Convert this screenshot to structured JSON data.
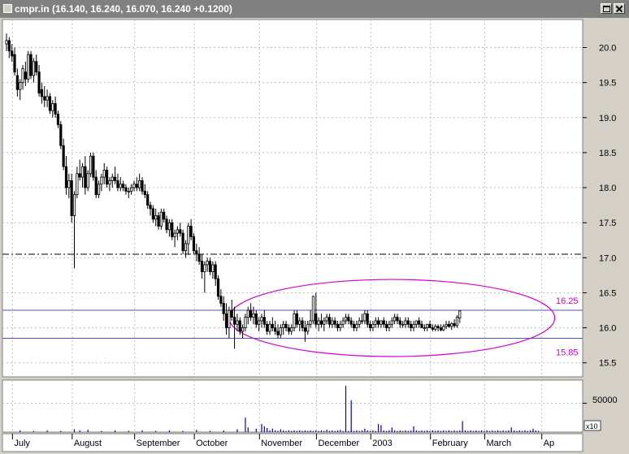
{
  "window": {
    "symbol": "cmpr.in",
    "quote": "(16.140, 16.240, 16.070, 16.240 +0.1200)"
  },
  "colors": {
    "candle": "#000000",
    "volume": "#0000cc",
    "support_resistance": "#5050c0",
    "ellipse": "#d000d0",
    "level_label": "#cc00cc",
    "grid": "#c0c0c0",
    "background": "#ffffff"
  },
  "chart_data": {
    "type": "candlestick",
    "x_unit": "trading day index from first bar",
    "ylim": [
      15.3,
      20.4
    ],
    "price_ticks": [
      "20.0",
      "19.5",
      "19.0",
      "18.5",
      "18.0",
      "17.5",
      "17.0",
      "16.5",
      "16.0",
      "15.5"
    ],
    "month_labels": [
      {
        "label": "July",
        "day": 4
      },
      {
        "label": "August",
        "day": 26
      },
      {
        "label": "September",
        "day": 49
      },
      {
        "label": "October",
        "day": 71
      },
      {
        "label": "November",
        "day": 95
      },
      {
        "label": "December",
        "day": 116
      },
      {
        "label": "2003",
        "day": 136
      },
      {
        "label": "February",
        "day": 158
      },
      {
        "label": "March",
        "day": 178
      },
      {
        "label": "Ap",
        "day": 199
      }
    ],
    "reference_lines": [
      {
        "value": 17.05,
        "style": "dash-dot"
      },
      {
        "value": 16.25,
        "style": "solid",
        "label": "16.25"
      },
      {
        "value": 15.85,
        "style": "solid",
        "label": "15.85"
      }
    ],
    "ellipse": {
      "day_from": 82,
      "day_to": 202,
      "price_from": 15.59,
      "price_to": 16.69
    },
    "volume_axis": {
      "label": "50000",
      "tick_value": 50000,
      "scale_label": "x10",
      "ylim": [
        0,
        90000
      ]
    },
    "last_close": 16.24,
    "ohlc": [
      [
        20.05,
        20.2,
        19.95,
        20.1
      ],
      [
        20.1,
        20.15,
        19.85,
        19.95
      ],
      [
        19.95,
        20.05,
        19.8,
        19.88
      ],
      [
        19.9,
        20.0,
        19.6,
        19.65
      ],
      [
        19.6,
        19.7,
        19.3,
        19.4
      ],
      [
        19.4,
        19.55,
        19.25,
        19.5
      ],
      [
        19.5,
        19.75,
        19.4,
        19.7
      ],
      [
        19.65,
        19.8,
        19.45,
        19.55
      ],
      [
        19.55,
        19.95,
        19.5,
        19.9
      ],
      [
        19.9,
        19.95,
        19.55,
        19.6
      ],
      [
        19.6,
        19.85,
        19.5,
        19.8
      ],
      [
        19.8,
        19.9,
        19.6,
        19.65
      ],
      [
        19.65,
        19.75,
        19.3,
        19.35
      ],
      [
        19.4,
        19.5,
        19.2,
        19.3
      ],
      [
        19.3,
        19.45,
        19.15,
        19.25
      ],
      [
        19.25,
        19.4,
        19.15,
        19.3
      ],
      [
        19.3,
        19.35,
        19.05,
        19.1
      ],
      [
        19.1,
        19.25,
        19.0,
        19.2
      ],
      [
        19.2,
        19.3,
        19.0,
        19.05
      ],
      [
        19.05,
        19.1,
        18.85,
        18.9
      ],
      [
        18.9,
        18.95,
        18.55,
        18.6
      ],
      [
        18.6,
        18.7,
        18.25,
        18.3
      ],
      [
        18.3,
        18.45,
        17.9,
        18.0
      ],
      [
        18.0,
        18.2,
        17.85,
        18.1
      ],
      [
        18.1,
        18.2,
        17.5,
        17.6
      ],
      [
        17.6,
        17.95,
        16.85,
        17.9
      ],
      [
        17.9,
        18.3,
        17.85,
        18.2
      ],
      [
        18.2,
        18.4,
        18.1,
        18.15
      ],
      [
        18.15,
        18.35,
        18.0,
        18.3
      ],
      [
        18.3,
        18.45,
        17.9,
        18.0
      ],
      [
        18.0,
        18.25,
        17.95,
        18.2
      ],
      [
        18.2,
        18.5,
        18.15,
        18.45
      ],
      [
        18.45,
        18.5,
        18.1,
        18.15
      ],
      [
        18.15,
        18.25,
        17.85,
        17.9
      ],
      [
        17.9,
        18.1,
        17.85,
        18.05
      ],
      [
        18.05,
        18.2,
        17.95,
        18.15
      ],
      [
        18.15,
        18.35,
        18.05,
        18.25
      ],
      [
        18.25,
        18.3,
        18.0,
        18.05
      ],
      [
        18.05,
        18.15,
        17.95,
        18.1
      ],
      [
        18.1,
        18.2,
        18.0,
        18.15
      ],
      [
        18.15,
        18.3,
        18.05,
        18.1
      ],
      [
        18.1,
        18.2,
        17.95,
        18.0
      ],
      [
        18.0,
        18.15,
        17.95,
        18.05
      ],
      [
        18.05,
        18.1,
        17.95,
        18.0
      ],
      [
        18.0,
        18.05,
        17.9,
        17.95
      ],
      [
        17.95,
        18.0,
        17.85,
        17.95
      ],
      [
        17.95,
        18.05,
        17.9,
        18.0
      ],
      [
        18.0,
        18.1,
        17.95,
        18.05
      ],
      [
        18.05,
        18.15,
        17.95,
        18.0
      ],
      [
        18.0,
        18.2,
        17.95,
        18.1
      ],
      [
        18.1,
        18.15,
        17.9,
        17.95
      ],
      [
        17.95,
        18.05,
        17.85,
        17.9
      ],
      [
        17.9,
        17.95,
        17.7,
        17.75
      ],
      [
        17.75,
        17.8,
        17.6,
        17.7
      ],
      [
        17.7,
        17.75,
        17.5,
        17.55
      ],
      [
        17.55,
        17.7,
        17.45,
        17.6
      ],
      [
        17.6,
        17.65,
        17.4,
        17.45
      ],
      [
        17.45,
        17.7,
        17.4,
        17.65
      ],
      [
        17.65,
        17.7,
        17.5,
        17.55
      ],
      [
        17.55,
        17.6,
        17.35,
        17.4
      ],
      [
        17.4,
        17.55,
        17.3,
        17.5
      ],
      [
        17.5,
        17.55,
        17.25,
        17.3
      ],
      [
        17.3,
        17.4,
        17.15,
        17.35
      ],
      [
        17.35,
        17.45,
        17.25,
        17.4
      ],
      [
        17.4,
        17.5,
        17.3,
        17.35
      ],
      [
        17.35,
        17.4,
        17.05,
        17.1
      ],
      [
        17.1,
        17.25,
        17.0,
        17.2
      ],
      [
        17.2,
        17.5,
        17.05,
        17.45
      ],
      [
        17.45,
        17.55,
        17.25,
        17.3
      ],
      [
        17.3,
        17.35,
        17.05,
        17.1
      ],
      [
        17.1,
        17.2,
        16.95,
        17.05
      ],
      [
        17.05,
        17.15,
        16.9,
        16.95
      ],
      [
        16.95,
        17.05,
        16.7,
        16.8
      ],
      [
        16.8,
        16.95,
        16.5,
        16.9
      ],
      [
        16.9,
        17.0,
        16.8,
        16.95
      ],
      [
        16.95,
        17.0,
        16.75,
        16.8
      ],
      [
        16.8,
        16.95,
        16.7,
        16.9
      ],
      [
        16.9,
        16.95,
        16.6,
        16.7
      ],
      [
        16.7,
        16.75,
        16.4,
        16.45
      ],
      [
        16.45,
        16.55,
        16.3,
        16.35
      ],
      [
        16.35,
        16.45,
        16.1,
        16.2
      ],
      [
        16.2,
        16.35,
        15.9,
        16.0
      ],
      [
        16.0,
        16.3,
        15.85,
        16.25
      ],
      [
        16.25,
        16.4,
        16.1,
        16.15
      ],
      [
        16.15,
        16.3,
        15.7,
        16.05
      ],
      [
        16.05,
        16.2,
        15.95,
        16.1
      ],
      [
        16.1,
        16.15,
        15.9,
        15.95
      ],
      [
        15.95,
        16.05,
        15.85,
        16.0
      ],
      [
        16.0,
        16.2,
        15.95,
        16.15
      ],
      [
        16.15,
        16.3,
        16.05,
        16.25
      ],
      [
        16.25,
        16.35,
        16.1,
        16.15
      ],
      [
        16.15,
        16.3,
        16.05,
        16.2
      ],
      [
        16.2,
        16.25,
        16.0,
        16.05
      ],
      [
        16.05,
        16.15,
        15.95,
        16.1
      ],
      [
        16.1,
        16.2,
        16.0,
        16.15
      ],
      [
        16.15,
        16.25,
        16.0,
        16.05
      ],
      [
        16.05,
        16.1,
        15.9,
        15.95
      ],
      [
        15.95,
        16.1,
        15.9,
        16.05
      ],
      [
        16.05,
        16.15,
        15.95,
        16.0
      ],
      [
        16.0,
        16.1,
        15.9,
        15.95
      ],
      [
        15.95,
        16.05,
        15.85,
        15.9
      ],
      [
        15.9,
        16.05,
        15.85,
        16.0
      ],
      [
        16.0,
        16.1,
        15.9,
        16.05
      ],
      [
        16.05,
        16.1,
        15.95,
        16.0
      ],
      [
        16.0,
        16.05,
        15.9,
        15.95
      ],
      [
        15.95,
        16.05,
        15.9,
        16.0
      ],
      [
        16.0,
        16.25,
        15.95,
        16.2
      ],
      [
        16.2,
        16.25,
        16.0,
        16.05
      ],
      [
        16.05,
        16.15,
        15.95,
        16.1
      ],
      [
        16.1,
        16.15,
        15.95,
        16.0
      ],
      [
        16.0,
        16.1,
        15.8,
        15.95
      ],
      [
        15.95,
        16.1,
        15.9,
        16.05
      ],
      [
        16.05,
        16.25,
        16.0,
        16.1
      ],
      [
        16.1,
        16.35,
        16.05,
        16.45
      ],
      [
        16.2,
        16.5,
        16.0,
        16.05
      ],
      [
        16.05,
        16.15,
        15.95,
        16.1
      ],
      [
        16.1,
        16.2,
        16.0,
        16.05
      ],
      [
        16.05,
        16.15,
        15.95,
        16.1
      ],
      [
        16.1,
        16.2,
        16.05,
        16.15
      ],
      [
        16.15,
        16.2,
        16.0,
        16.05
      ],
      [
        16.05,
        16.15,
        16.0,
        16.1
      ],
      [
        16.1,
        16.15,
        16.0,
        16.05
      ],
      [
        16.05,
        16.1,
        15.95,
        16.0
      ],
      [
        16.0,
        16.1,
        15.95,
        16.05
      ],
      [
        16.05,
        16.15,
        16.0,
        16.1
      ],
      [
        16.1,
        16.2,
        16.05,
        16.15
      ],
      [
        16.15,
        16.2,
        16.05,
        16.1
      ],
      [
        16.1,
        16.15,
        16.0,
        16.05
      ],
      [
        16.05,
        16.1,
        15.95,
        16.0
      ],
      [
        16.0,
        16.1,
        15.95,
        16.05
      ],
      [
        16.05,
        16.15,
        16.0,
        16.1
      ],
      [
        16.1,
        16.2,
        16.05,
        16.1
      ],
      [
        16.1,
        16.25,
        16.05,
        16.2
      ],
      [
        16.2,
        16.25,
        16.0,
        16.05
      ],
      [
        16.05,
        16.1,
        15.95,
        16.0
      ],
      [
        16.0,
        16.1,
        15.95,
        16.05
      ],
      [
        16.05,
        16.15,
        16.0,
        16.1
      ],
      [
        16.1,
        16.15,
        16.0,
        16.05
      ],
      [
        16.05,
        16.1,
        16.0,
        16.1
      ],
      [
        16.1,
        16.15,
        16.0,
        16.05
      ],
      [
        16.05,
        16.1,
        15.95,
        16.0
      ],
      [
        16.0,
        16.1,
        15.95,
        16.05
      ],
      [
        16.05,
        16.15,
        16.0,
        16.1
      ],
      [
        16.1,
        16.2,
        16.05,
        16.15
      ],
      [
        16.15,
        16.2,
        16.05,
        16.1
      ],
      [
        16.1,
        16.15,
        16.0,
        16.05
      ],
      [
        16.05,
        16.1,
        16.0,
        16.05
      ],
      [
        16.05,
        16.15,
        16.0,
        16.1
      ],
      [
        16.1,
        16.15,
        16.0,
        16.05
      ],
      [
        16.05,
        16.1,
        15.95,
        16.0
      ],
      [
        16.0,
        16.1,
        15.95,
        16.05
      ],
      [
        16.05,
        16.1,
        16.0,
        16.1
      ],
      [
        16.1,
        16.15,
        16.0,
        16.05
      ],
      [
        16.05,
        16.1,
        16.0,
        16.0
      ],
      [
        16.0,
        16.05,
        15.95,
        16.0
      ],
      [
        16.0,
        16.05,
        15.95,
        16.05
      ],
      [
        16.05,
        16.1,
        16.0,
        16.0
      ],
      [
        16.0,
        16.05,
        15.95,
        15.98
      ],
      [
        15.98,
        16.05,
        15.95,
        16.02
      ],
      [
        16.02,
        16.05,
        15.95,
        16.0
      ],
      [
        16.0,
        16.05,
        15.95,
        15.97
      ],
      [
        15.97,
        16.05,
        15.95,
        16.02
      ],
      [
        16.02,
        16.1,
        15.98,
        16.05
      ],
      [
        16.05,
        16.1,
        16.0,
        16.02
      ],
      [
        16.02,
        16.08,
        15.97,
        16.06
      ],
      [
        16.06,
        16.12,
        16.0,
        16.03
      ],
      [
        16.03,
        16.18,
        16.0,
        16.15
      ],
      [
        16.14,
        16.24,
        16.07,
        16.24
      ]
    ],
    "volume": [
      [
        97,
        3000
      ],
      [
        98,
        6000
      ],
      [
        99,
        3000
      ],
      [
        100,
        2000
      ],
      [
        101,
        5000
      ],
      [
        102,
        3000
      ],
      [
        103,
        2000
      ],
      [
        104,
        3000
      ],
      [
        105,
        2000
      ],
      [
        106,
        3000
      ],
      [
        107,
        2000
      ],
      [
        108,
        3000
      ],
      [
        109,
        2000
      ],
      [
        110,
        3000
      ],
      [
        111,
        2000
      ],
      [
        112,
        3000
      ],
      [
        113,
        2000
      ],
      [
        114,
        3000
      ],
      [
        115,
        2000
      ],
      [
        116,
        3000
      ],
      [
        117,
        2000
      ],
      [
        118,
        4000
      ],
      [
        119,
        2000
      ],
      [
        120,
        3000
      ],
      [
        121,
        2000
      ],
      [
        122,
        3000
      ],
      [
        123,
        4000
      ],
      [
        124,
        2000
      ],
      [
        125,
        3000
      ],
      [
        126,
        2000
      ],
      [
        127,
        3000
      ],
      [
        128,
        2000
      ],
      [
        129,
        3000
      ],
      [
        130,
        2000
      ],
      [
        131,
        3000
      ],
      [
        132,
        6000
      ],
      [
        133,
        3000
      ],
      [
        134,
        2000
      ],
      [
        135,
        3000
      ],
      [
        136,
        2000
      ],
      [
        137,
        3000
      ],
      [
        138,
        12000
      ],
      [
        139,
        3000
      ],
      [
        140,
        2000
      ],
      [
        141,
        3000
      ],
      [
        142,
        2000
      ],
      [
        143,
        3000
      ],
      [
        144,
        2000
      ],
      [
        145,
        3000
      ],
      [
        146,
        2000
      ],
      [
        147,
        3000
      ],
      [
        148,
        2000
      ],
      [
        149,
        3000
      ],
      [
        150,
        2000
      ],
      [
        151,
        3000
      ],
      [
        152,
        2000
      ],
      [
        153,
        3000
      ],
      [
        154,
        2000
      ],
      [
        155,
        3000
      ],
      [
        156,
        2000
      ],
      [
        157,
        3000
      ],
      [
        158,
        2000
      ],
      [
        159,
        3000
      ],
      [
        160,
        2000
      ],
      [
        161,
        3000
      ],
      [
        162,
        2000
      ],
      [
        163,
        3000
      ],
      [
        164,
        2000
      ],
      [
        165,
        3000
      ],
      [
        166,
        2000
      ],
      [
        167,
        3000
      ],
      [
        168,
        2000
      ],
      [
        169,
        3000
      ],
      [
        170,
        2000
      ],
      [
        171,
        3000
      ],
      [
        172,
        2000
      ],
      [
        173,
        3000
      ],
      [
        174,
        2000
      ],
      [
        175,
        3000
      ],
      [
        176,
        2000
      ],
      [
        177,
        3000
      ],
      [
        178,
        2000
      ],
      [
        179,
        3000
      ],
      [
        180,
        2000
      ],
      [
        181,
        3000
      ],
      [
        182,
        2000
      ],
      [
        183,
        3000
      ],
      [
        184,
        2000
      ],
      [
        185,
        3000
      ],
      [
        186,
        2000
      ],
      [
        187,
        3000
      ],
      [
        188,
        2000
      ],
      [
        189,
        3000
      ],
      [
        190,
        2000
      ],
      [
        191,
        3000
      ],
      [
        192,
        2000
      ],
      [
        193,
        3000
      ],
      [
        194,
        2000
      ],
      [
        195,
        3000
      ],
      [
        196,
        2000
      ],
      [
        5,
        3000
      ],
      [
        10,
        2000
      ],
      [
        15,
        3000
      ],
      [
        20,
        2000
      ],
      [
        25,
        5000
      ],
      [
        27,
        3000
      ],
      [
        30,
        4000
      ],
      [
        35,
        2000
      ],
      [
        40,
        3000
      ],
      [
        45,
        2000
      ],
      [
        50,
        3000
      ],
      [
        55,
        2000
      ],
      [
        60,
        3000
      ],
      [
        65,
        2000
      ],
      [
        70,
        4000
      ],
      [
        75,
        2000
      ],
      [
        80,
        3000
      ],
      [
        85,
        5000
      ],
      [
        88,
        25000
      ],
      [
        89,
        8000
      ],
      [
        92,
        6000
      ],
      [
        94,
        14000
      ],
      [
        95,
        10000
      ],
      [
        96,
        7000
      ],
      [
        125,
        80000
      ],
      [
        127,
        55000
      ],
      [
        137,
        14000
      ],
      [
        142,
        8000
      ],
      [
        150,
        10000
      ],
      [
        168,
        19000
      ],
      [
        186,
        8000
      ],
      [
        194,
        6000
      ]
    ]
  }
}
